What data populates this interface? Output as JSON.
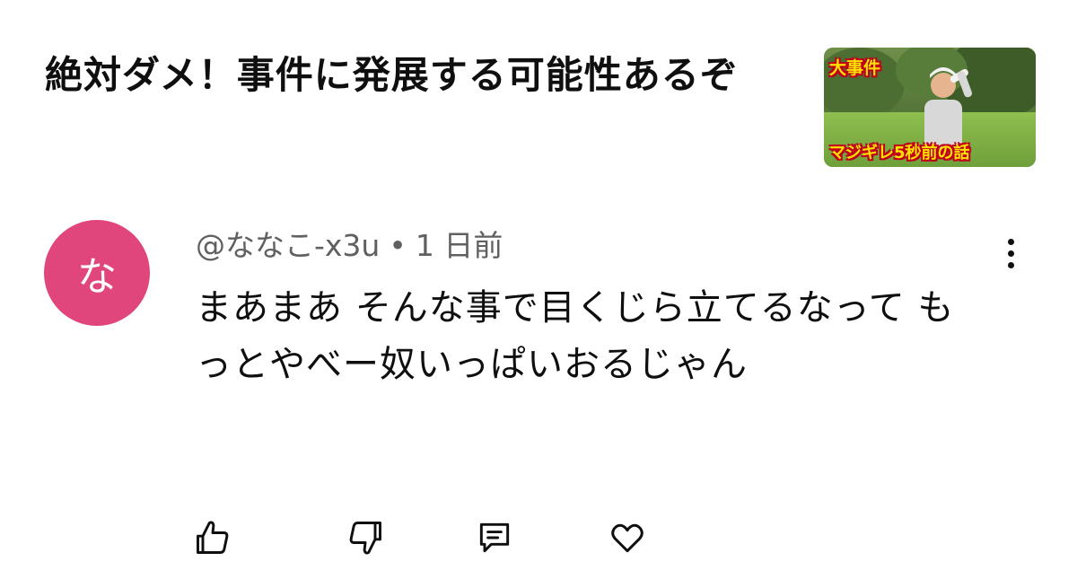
{
  "video": {
    "title": "絶対ダメ！事件に発展する可能性あるぞ",
    "thumbnail": {
      "top_text": "大事件",
      "bottom_text": "マジギレ5秒前の話"
    }
  },
  "comment": {
    "avatar_initial": "な",
    "avatar_color": "#e0457b",
    "author": "@ななこ-x3u",
    "separator": "•",
    "timestamp": "1 日前",
    "text": "まあまあ そんな事で目くじら立てるなって もっとやべー奴いっぱいおるじゃん"
  },
  "actions": {
    "like_icon": "thumbs-up-icon",
    "dislike_icon": "thumbs-down-icon",
    "reply_icon": "reply-comment-icon",
    "heart_icon": "heart-icon",
    "menu_icon": "more-vertical-icon"
  }
}
